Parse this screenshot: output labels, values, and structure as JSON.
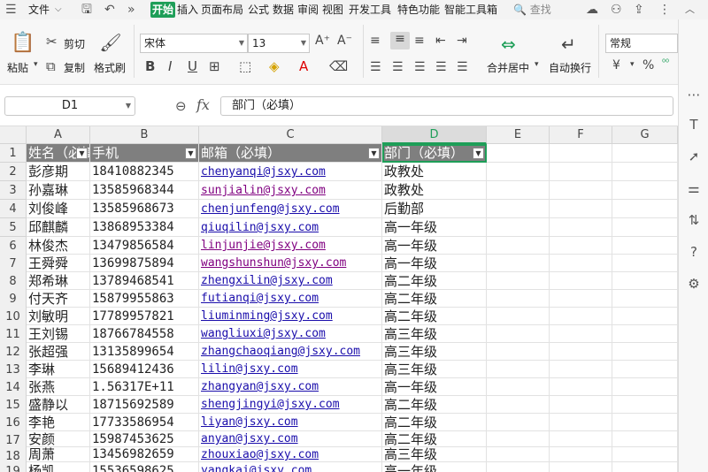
{
  "menubar": {
    "file": "文件",
    "tabs": [
      "开始",
      "插入",
      "页面布局",
      "公式",
      "数据",
      "审阅",
      "视图",
      "开发工具",
      "特色功能",
      "智能工具箱"
    ],
    "active_tab": "开始",
    "search": "查找"
  },
  "ribbon": {
    "paste": "粘贴",
    "cut": "剪切",
    "copy": "复制",
    "format_painter": "格式刷",
    "font_name": "宋体",
    "font_size": "13",
    "merge_center": "合并居中",
    "wrap_text": "自动换行",
    "number_format": "常规",
    "percent": "%"
  },
  "formula_bar": {
    "cell_ref": "D1",
    "fx": "fx",
    "content": "部门（必填）"
  },
  "columns": [
    "A",
    "B",
    "C",
    "D",
    "E",
    "F",
    "G"
  ],
  "selected_column": "D",
  "header_row": {
    "a": "姓名（必填）",
    "b": "手机",
    "c": "邮箱（必填）",
    "d": "部门（必填）"
  },
  "rows": [
    {
      "n": "2",
      "name": "彭彦期",
      "phone": "18410882345",
      "email": "chenyanqi@jsxy.com",
      "dept": "政教处"
    },
    {
      "n": "3",
      "name": "孙嘉琳",
      "phone": "13585968344",
      "email": "sunjialin@jsxy.com",
      "dept": "政教处"
    },
    {
      "n": "4",
      "name": "刘俊峰",
      "phone": "13585968673",
      "email": "chenjunfeng@jsxy.com",
      "dept": "后勤部"
    },
    {
      "n": "5",
      "name": "邱麒麟",
      "phone": "13868953384",
      "email": "qiuqilin@jsxy.com",
      "dept": "高一年级"
    },
    {
      "n": "6",
      "name": "林俊杰",
      "phone": "13479856584",
      "email": "linjunjie@jsxy.com",
      "dept": "高一年级"
    },
    {
      "n": "7",
      "name": "王舜舜",
      "phone": "13699875894",
      "email": "wangshunshun@jsxy.com",
      "dept": "高一年级"
    },
    {
      "n": "8",
      "name": "郑希琳",
      "phone": "13789468541",
      "email": "zhengxilin@jsxy.com",
      "dept": "高二年级"
    },
    {
      "n": "9",
      "name": "付天齐",
      "phone": "15879955863",
      "email": "futianqi@jsxy.com",
      "dept": "高二年级"
    },
    {
      "n": "10",
      "name": "刘敏明",
      "phone": "17789957821",
      "email": "liuminming@jsxy.com",
      "dept": "高二年级"
    },
    {
      "n": "11",
      "name": "王刘锡",
      "phone": "18766784558",
      "email": "wangliuxi@jsxy.com",
      "dept": "高三年级"
    },
    {
      "n": "12",
      "name": "张超强",
      "phone": "13135899654",
      "email": "zhangchaoqiang@jsxy.com",
      "dept": "高三年级"
    },
    {
      "n": "13",
      "name": "李琳",
      "phone": "15689412436",
      "email": "lilin@jsxy.com",
      "dept": "高三年级"
    },
    {
      "n": "14",
      "name": "张燕",
      "phone": "1.56317E+11",
      "email": "zhangyan@jsxy.com",
      "dept": "高一年级"
    },
    {
      "n": "15",
      "name": "盛静以",
      "phone": "18715692589",
      "email": "shengjingyi@jsxy.com",
      "dept": "高二年级"
    },
    {
      "n": "16",
      "name": "李艳",
      "phone": "17733586954",
      "email": "liyan@jsxy.com",
      "dept": "高二年级"
    },
    {
      "n": "17",
      "name": "安颜",
      "phone": "15987453625",
      "email": "anyan@jsxy.com",
      "dept": "高二年级"
    },
    {
      "n": "18",
      "name": "周萧",
      "phone": "13456982659",
      "email": "zhouxiao@jsxy.com",
      "dept": "高三年级"
    },
    {
      "n": "19",
      "name": "杨凯",
      "phone": "15536598625",
      "email": "yangkai@jsxy.com",
      "dept": "高一年级"
    }
  ],
  "visited_email_rows": [
    "3",
    "6",
    "7"
  ]
}
